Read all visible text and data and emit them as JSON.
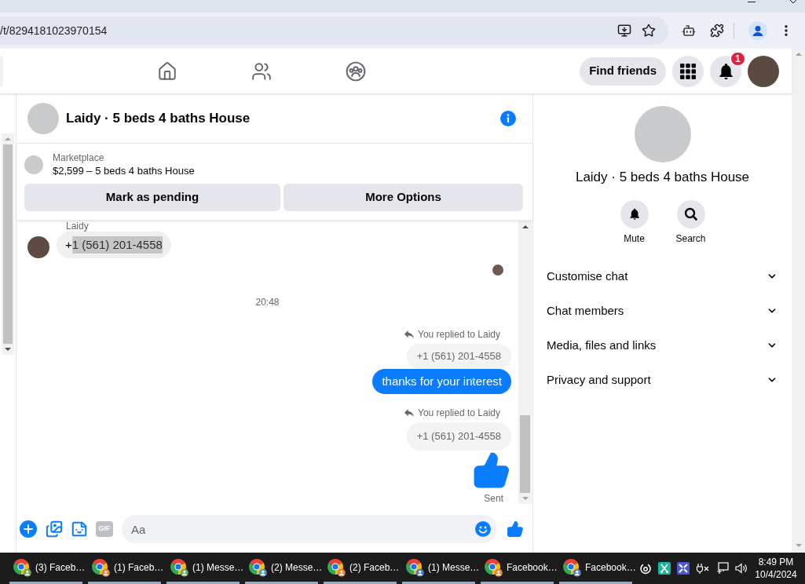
{
  "browser": {
    "url": "/t/8294181023970154"
  },
  "top_nav": {
    "find_friends": "Find friends",
    "notification_count": "1"
  },
  "chat": {
    "title": "Laidy · 5 beds 4 baths House",
    "listing": {
      "label": "Marketplace",
      "summary": "$2,599 – 5 beds 4 baths House"
    },
    "actions": [
      "Mark as pending",
      "More Options"
    ],
    "messages": [
      {
        "kind": "incoming",
        "sender": "Laidy",
        "parts": [
          {
            "text": "+",
            "selected": false
          },
          {
            "text": "1 (561) 201-4558",
            "selected": true
          }
        ]
      },
      {
        "kind": "seen"
      },
      {
        "kind": "timestamp",
        "text": "20:48"
      },
      {
        "kind": "reply",
        "note": "You replied to Laidy",
        "quoted": "+1 (561) 201-4558",
        "text": "thanks for your interest"
      },
      {
        "kind": "reply_like",
        "note": "You replied to Laidy",
        "quoted": "+1 (561) 201-4558",
        "status": "Sent"
      }
    ],
    "composer": {
      "gif": "GIF",
      "placeholder": "Aa"
    }
  },
  "details": {
    "title": "Laidy · 5 beds 4 baths House",
    "actions": [
      {
        "kind": "mute",
        "label": "Mute"
      },
      {
        "kind": "search",
        "label": "Search"
      }
    ],
    "sections": [
      {
        "label": "Customise chat",
        "expanded": false
      },
      {
        "label": "Chat members",
        "expanded": false
      },
      {
        "label": "Media, files and links",
        "expanded": false
      },
      {
        "label": "Privacy and support",
        "expanded": false
      }
    ]
  },
  "taskbar": {
    "windows": [
      {
        "title": "(3) Faceb…",
        "color": "#6aa84f"
      },
      {
        "title": "(1) Faceb…",
        "color": "#e8833a"
      },
      {
        "title": "(1) Messe…",
        "color": "#6aa86a"
      },
      {
        "title": "(2) Messe…",
        "color": "#4e9cc4"
      },
      {
        "title": "(2) Faceb…",
        "color": "#e8833a"
      },
      {
        "title": "(1) Messe…",
        "color": "#4a78d0"
      },
      {
        "title": "Facebook…",
        "color": "#e8833a"
      },
      {
        "title": "Facebook…",
        "color": "#5a7fd0"
      }
    ],
    "time": "8:49 PM",
    "date": "10/4/2024"
  }
}
